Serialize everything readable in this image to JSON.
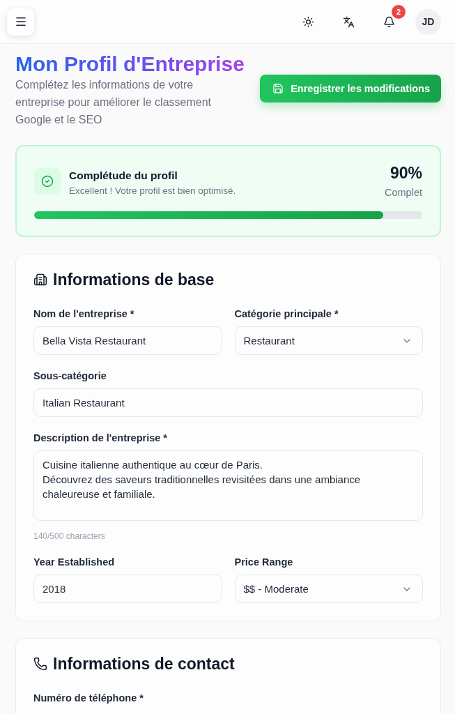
{
  "header": {
    "notification_count": "2",
    "avatar_initials": "JD"
  },
  "page": {
    "title": "Mon Profil d'Entreprise",
    "subtitle": "Complétez les informations de votre entreprise pour améliorer le classement Google et le SEO",
    "save_button": "Enregistrer les modifications"
  },
  "completeness": {
    "title": "Complétude du profil",
    "message": "Excellent ! Votre profil est bien optimisé.",
    "percent": "90%",
    "percent_label": "Complet",
    "level": 0.9
  },
  "sections": [
    {
      "title": "Informations de base",
      "rows": [
        {
          "fields": [
            {
              "label": "Nom de l'entreprise *",
              "kind": "text",
              "value": "Bella Vista Restaurant"
            },
            {
              "label": "Catégorie principale *",
              "kind": "select",
              "value": "Restaurant"
            }
          ]
        },
        {
          "fields": [
            {
              "label": "Sous-catégorie",
              "kind": "text",
              "value": "Italian Restaurant"
            }
          ]
        },
        {
          "fields": [
            {
              "label": "Description de l'entreprise *",
              "kind": "textarea",
              "value": "Cuisine italienne authentique au cœur de Paris.\nDécouvrez des saveurs traditionnelles revisitées dans une ambiance chaleureuse et familiale.",
              "counter": "140/500 characters"
            }
          ]
        },
        {
          "fields": [
            {
              "label": "Year Established",
              "kind": "text",
              "value": "2018"
            },
            {
              "label": "Price Range",
              "kind": "select",
              "value": "$$ - Moderate"
            }
          ]
        }
      ]
    },
    {
      "title": "Informations de contact",
      "rows": [
        {
          "fields": [
            {
              "label": "Numéro de téléphone *"
            }
          ]
        }
      ]
    }
  ]
}
